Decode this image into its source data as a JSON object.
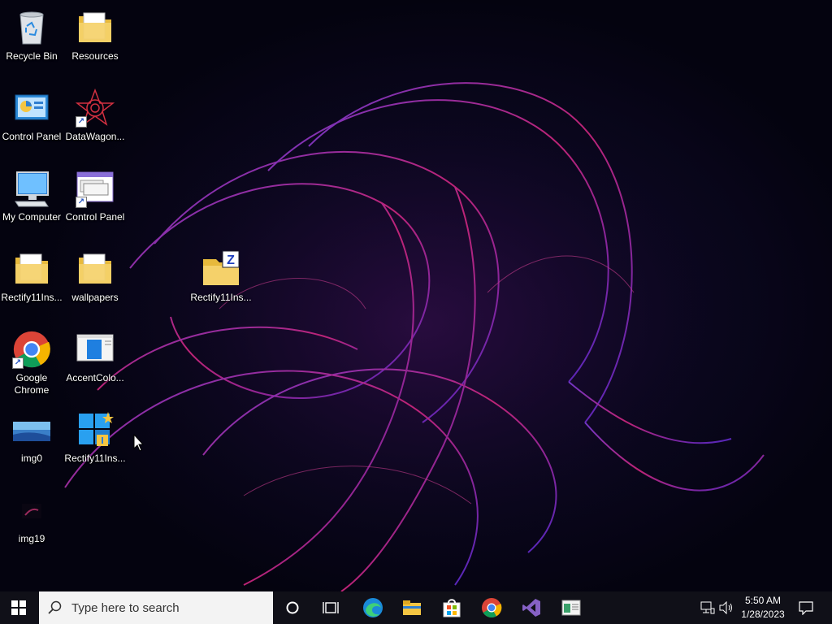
{
  "desktop": {
    "icons": [
      {
        "label": "Recycle Bin",
        "icon": "recycle-bin-icon"
      },
      {
        "label": "Resources",
        "icon": "folder-icon"
      },
      {
        "label": "Control Panel",
        "icon": "control-panel-icon"
      },
      {
        "label": "DataWagon...",
        "icon": "datawagon-icon"
      },
      {
        "label": "My Computer",
        "icon": "computer-icon"
      },
      {
        "label": "Control Panel",
        "icon": "control-panel-window-icon"
      },
      {
        "label": "Rectify11Ins...",
        "icon": "folder-icon"
      },
      {
        "label": "wallpapers",
        "icon": "folder-icon"
      },
      {
        "label": "Rectify11Ins...",
        "icon": "zip-folder-icon"
      },
      {
        "label": "Google Chrome",
        "icon": "chrome-icon"
      },
      {
        "label": "AccentColo...",
        "icon": "accent-color-app-icon"
      },
      {
        "label": "img0",
        "icon": "image-icon"
      },
      {
        "label": "Rectify11Ins...",
        "icon": "installer-icon"
      },
      {
        "label": "img19",
        "icon": "image-icon"
      }
    ]
  },
  "taskbar": {
    "start_icon": "windows-logo-icon",
    "search_placeholder": "Type here to search",
    "pinned": [
      "cortana-icon",
      "task-view-icon",
      "edge-icon",
      "file-explorer-icon",
      "store-icon",
      "chrome-icon",
      "visual-studio-icon",
      "app-window-icon"
    ],
    "tray": {
      "network_icon": "network-icon",
      "volume_icon": "volume-icon",
      "time": "5:50 AM",
      "date": "1/28/2023",
      "notification_icon": "notification-icon"
    }
  }
}
